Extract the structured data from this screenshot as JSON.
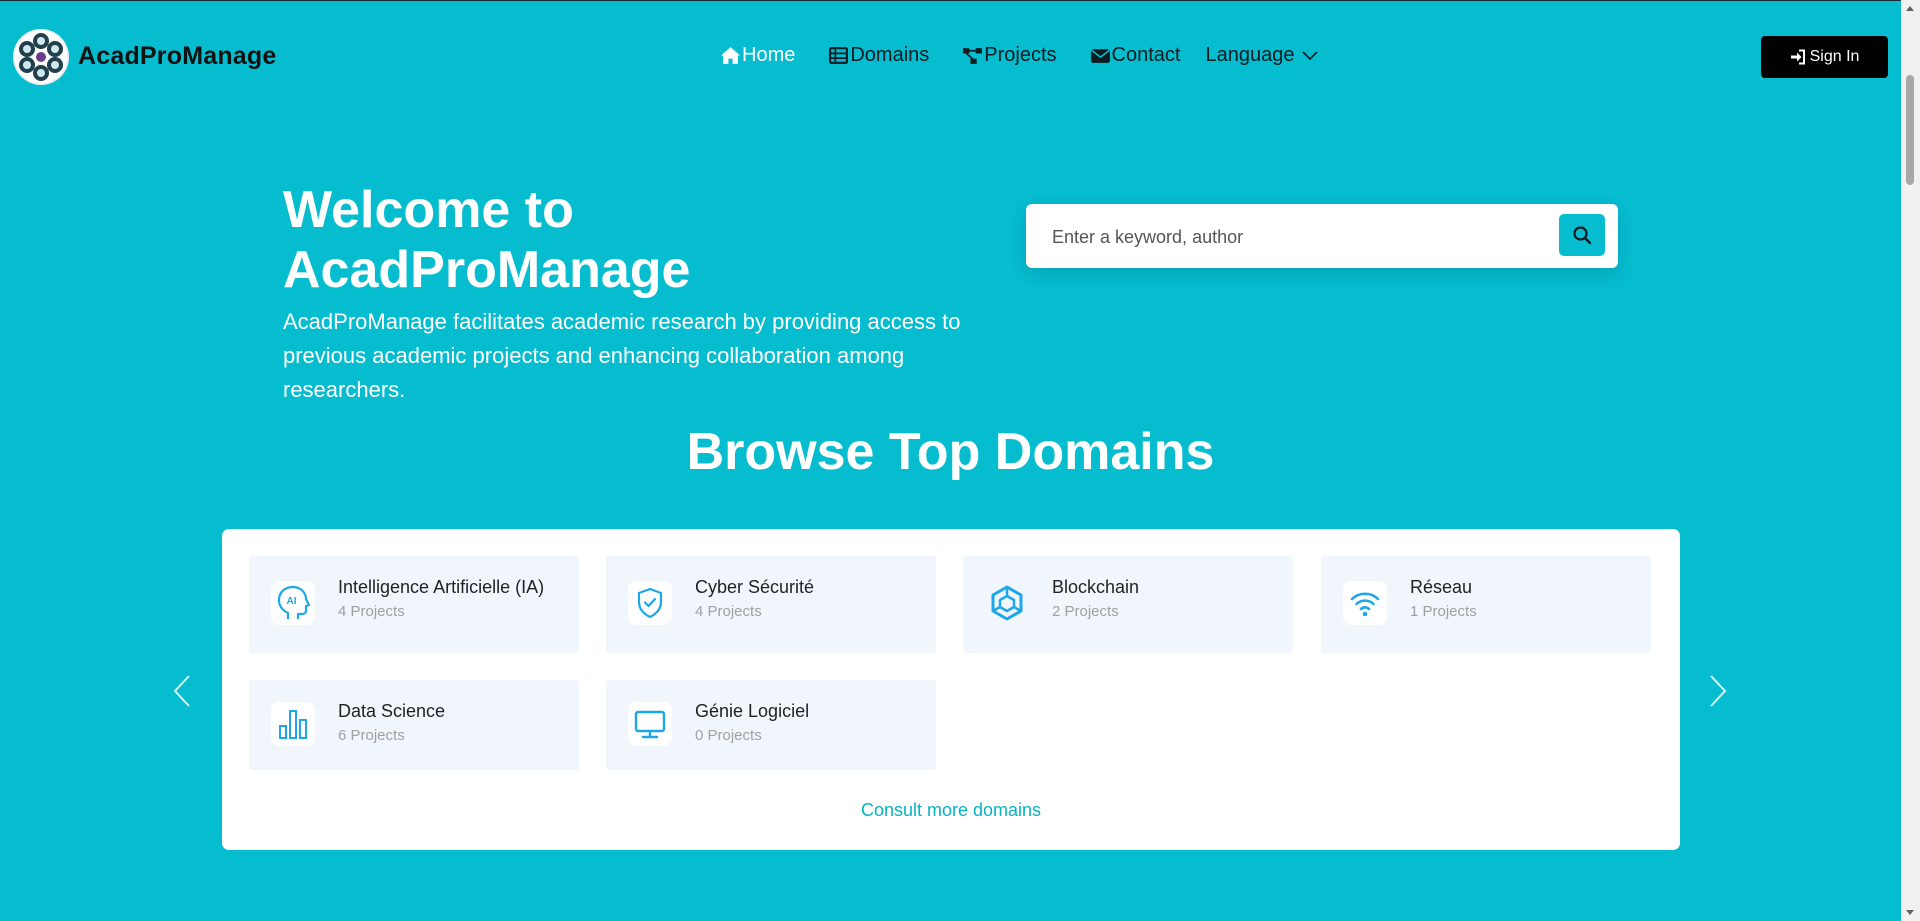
{
  "brand": {
    "name": "AcadProManage"
  },
  "nav": {
    "items": [
      {
        "label": "Home",
        "icon": "home-icon",
        "active": true
      },
      {
        "label": "Domains",
        "icon": "list-icon"
      },
      {
        "label": "Projects",
        "icon": "diagram-icon"
      },
      {
        "label": "Contact",
        "icon": "envelope-icon"
      }
    ],
    "language": {
      "label": "Language",
      "icon": "chevron-down-icon"
    },
    "sign_in": {
      "label": "Sign In",
      "icon": "sign-in-icon"
    }
  },
  "hero": {
    "title": "Welcome to\nAcadProManage",
    "description": "AcadProManage facilitates academic research by providing access to previous academic projects and enhancing collaboration among researchers.",
    "search": {
      "placeholder": "Enter a keyword, author",
      "value": "",
      "icon": "search-icon"
    }
  },
  "domains": {
    "title": "Browse Top Domains",
    "cards": [
      {
        "name": "Intelligence Artificielle (IA)",
        "count": "4 Projects",
        "icon": "ai-head-icon"
      },
      {
        "name": "Cyber Sécurité",
        "count": "4 Projects",
        "icon": "shield-check-icon"
      },
      {
        "name": "Blockchain",
        "count": "2 Projects",
        "icon": "blockchain-icon"
      },
      {
        "name": "Réseau",
        "count": "1 Projects",
        "icon": "wifi-icon"
      },
      {
        "name": "Data Science",
        "count": "6 Projects",
        "icon": "bar-chart-icon"
      },
      {
        "name": "Génie Logiciel",
        "count": "0 Projects",
        "icon": "monitor-icon"
      }
    ],
    "more_link": "Consult more domains",
    "prev_icon": "chevron-left-icon",
    "next_icon": "chevron-right-icon"
  },
  "colors": {
    "background": "#06bccf",
    "card_bg": "#f1f6fd",
    "icon_blue": "#1ea7e8",
    "link": "#06b3c5",
    "button_dark": "#000000"
  }
}
